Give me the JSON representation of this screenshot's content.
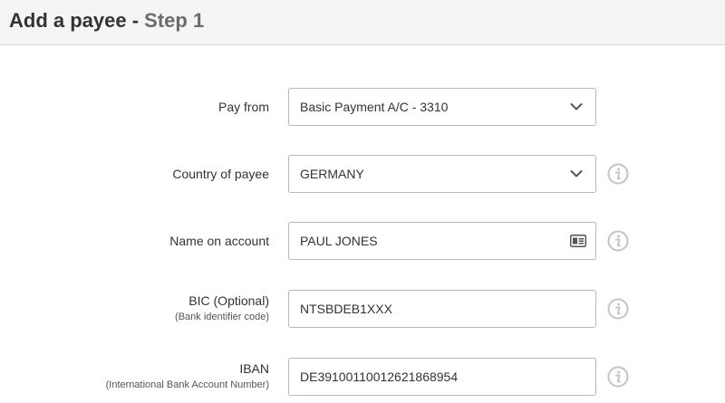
{
  "header": {
    "title_main": "Add a payee - ",
    "title_step": "Step 1"
  },
  "form": {
    "pay_from": {
      "label": "Pay from",
      "value": "Basic Payment A/C - 3310",
      "icon": "chevron-down-icon"
    },
    "country": {
      "label": "Country of payee",
      "value": "GERMANY",
      "icon": "chevron-down-icon",
      "info_icon": "info-icon"
    },
    "name": {
      "label": "Name on account",
      "value": "PAUL JONES",
      "icon": "id-card-icon",
      "info_icon": "info-icon"
    },
    "bic": {
      "label": "BIC (Optional)",
      "sublabel": "(Bank identifier code)",
      "value": "NTSBDEB1XXX",
      "info_icon": "info-icon"
    },
    "iban": {
      "label": "IBAN",
      "sublabel": "(International Bank Account Number)",
      "value": "DE39100110012621868954",
      "info_icon": "info-icon"
    }
  },
  "colors": {
    "header_bg": "#f5f5f5",
    "border": "#b8b8b8",
    "text": "#333333",
    "step_text": "#6b6b6b",
    "icon": "#c4c4c4"
  }
}
